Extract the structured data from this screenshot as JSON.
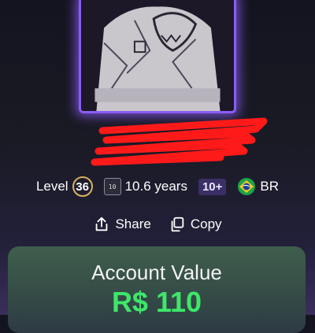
{
  "profile": {
    "level_label": "Level",
    "level_value": "36",
    "years_icon_text": "10",
    "years_text": "10.6 years",
    "rank_badge": "10+",
    "country_code": "BR",
    "frame_color": "#8b5cf6"
  },
  "actions": {
    "share_label": "Share",
    "copy_label": "Copy"
  },
  "account": {
    "title": "Account Value",
    "value": "R$ 110",
    "value_color": "#3ee66a"
  },
  "icons": {
    "share": "share-icon",
    "copy": "copy-icon",
    "flag": "brazil-flag-icon"
  }
}
